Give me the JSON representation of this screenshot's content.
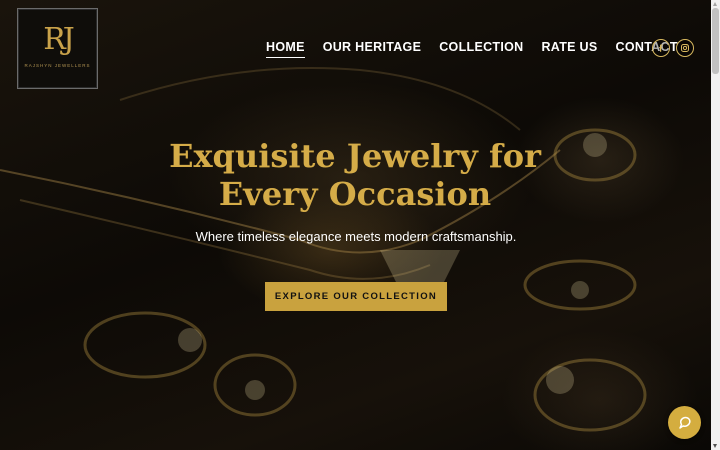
{
  "brand": {
    "monogram": "RJ",
    "name": "RAJSHYN JEWELLERS"
  },
  "nav": {
    "items": [
      {
        "label": "HOME",
        "active": true
      },
      {
        "label": "OUR HERITAGE",
        "active": false
      },
      {
        "label": "COLLECTION",
        "active": false
      },
      {
        "label": "RATE US",
        "active": false
      },
      {
        "label": "CONTACT",
        "active": false
      }
    ]
  },
  "social": {
    "icons": [
      "facebook-icon",
      "instagram-icon"
    ]
  },
  "hero": {
    "headline": "Exquisite Jewelry for Every Occasion",
    "subtitle": "Where timeless elegance meets modern craftsmanship.",
    "cta_label": "EXPLORE OUR COLLECTION"
  },
  "chat": {
    "icon": "chat-icon"
  },
  "colors": {
    "gold": "#d5ac48",
    "cta_background": "#c9a23e",
    "background": "#0b0906"
  }
}
